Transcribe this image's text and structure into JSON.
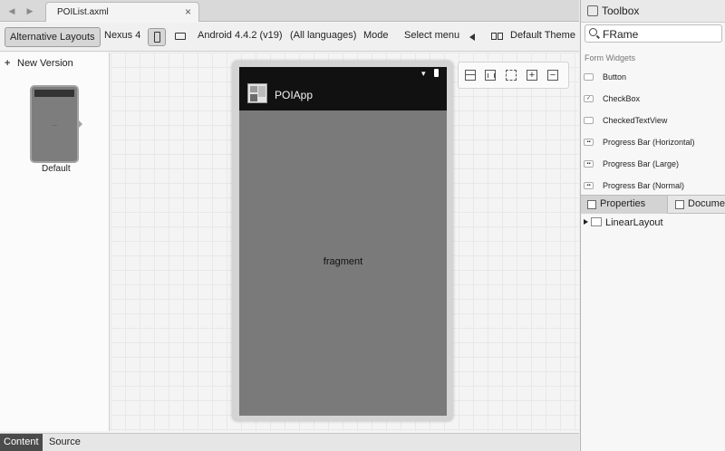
{
  "tabbar": {
    "document_tab": "POIList.axml",
    "close_glyph": "×",
    "back_glyph": "◀",
    "forward_glyph": "▶"
  },
  "toolbar": {
    "alternative_layouts": "Alternative Layouts",
    "device": "Nexus 4",
    "api_level": "Android 4.4.2 (v19)",
    "languages": "(All languages)",
    "mode": "Mode",
    "select_menu": "Select menu",
    "theme": "Default Theme"
  },
  "versions": {
    "new_version": "New Version",
    "default_label": "Default"
  },
  "device": {
    "app_title": "POIApp",
    "fragment_label": "fragment"
  },
  "bottom_tabs": {
    "content": "Content",
    "source": "Source"
  },
  "toolbox": {
    "title": "Toolbox",
    "search_value": "FRame",
    "section": "Form Widgets",
    "widgets": [
      {
        "label": "Button",
        "icon": "button-icon"
      },
      {
        "label": "CheckBox",
        "icon": "checkbox-icon"
      },
      {
        "label": "CheckedTextView",
        "icon": "checkedtextview-icon"
      },
      {
        "label": "Progress Bar (Horizontal)",
        "icon": "progressbar-icon"
      },
      {
        "label": "Progress Bar (Large)",
        "icon": "progressbar-icon"
      },
      {
        "label": "Progress Bar (Normal)",
        "icon": "progressbar-icon"
      }
    ]
  },
  "properties": {
    "properties_tab": "Properties",
    "document_tab": "Document Outline",
    "tree_root": "LinearLayout"
  }
}
